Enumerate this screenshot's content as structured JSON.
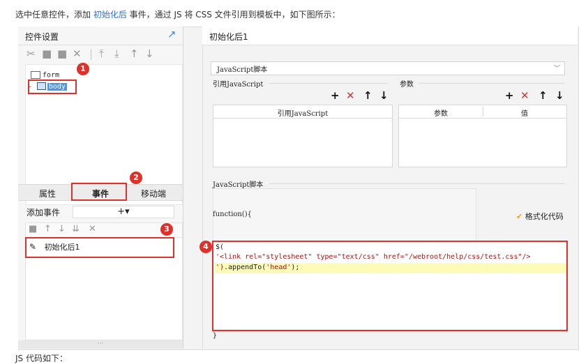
{
  "intro": {
    "part1": "选中任意控件，添加 ",
    "highlight": "初始化后",
    "part2": " 事件，通过 JS 将 CSS 文件引用到模板中，如下图所示："
  },
  "left_panel": {
    "title": "控件设置",
    "tree": {
      "form": "form",
      "body": "body"
    },
    "tabs": [
      "属性",
      "事件",
      "移动端"
    ],
    "add_event_label": "添加事件",
    "add_event_button": "+▾",
    "event_item": "初始化后1",
    "footer_dots": "···"
  },
  "right_panel": {
    "title": "初始化后1",
    "select_value": "JavaScript脚本",
    "ref_group": "引用JavaScript",
    "param_group": "参数",
    "ref_col": "引用JavaScript",
    "param_cols": [
      "参数",
      "值"
    ],
    "script_group": "JavaScript脚本",
    "func_start": "function(){",
    "format_button": "格式化代码",
    "code": [
      "$(",
      "'<link rel=\"stylesheet\" type=\"text/css\" href=\"/webroot/help/css/test.css\"/>",
      "').appendTo('head');"
    ],
    "func_end": "}"
  },
  "badges": [
    "1",
    "2",
    "3",
    "4"
  ],
  "bottom_cut": "JS 代码如下："
}
